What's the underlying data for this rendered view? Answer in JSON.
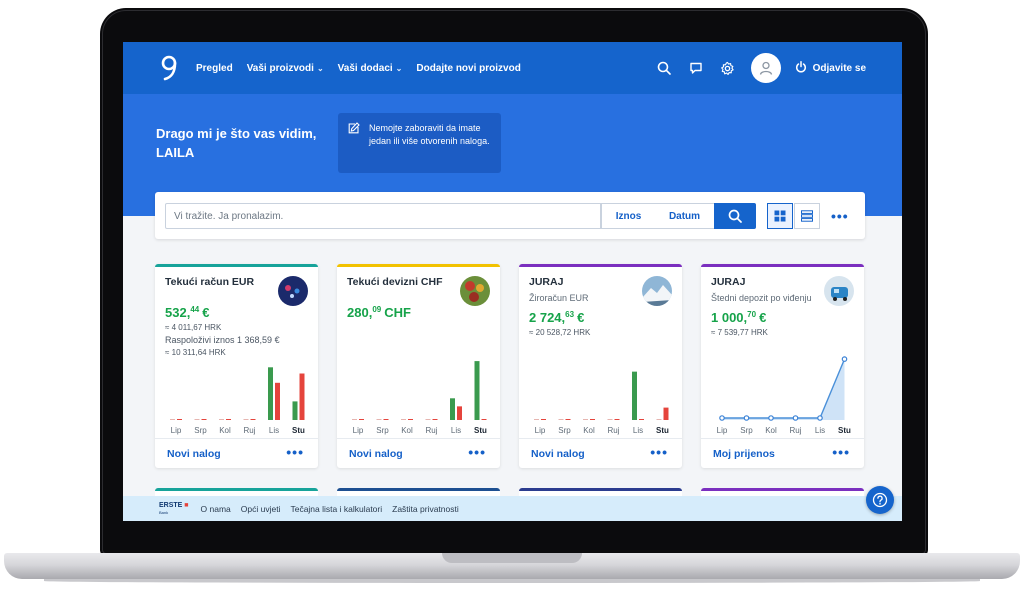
{
  "nav": {
    "items": [
      {
        "label": "Pregled",
        "dropdown": false
      },
      {
        "label": "Vaši proizvodi",
        "dropdown": true
      },
      {
        "label": "Vaši dodaci",
        "dropdown": true
      },
      {
        "label": "Dodajte novi proizvod",
        "dropdown": false
      }
    ],
    "logout_label": "Odjavite se",
    "icons": [
      "search-icon",
      "chat-icon",
      "settings-gear-icon",
      "user-avatar-icon",
      "power-icon"
    ]
  },
  "hero": {
    "greeting_line1": "Drago mi je što vas vidim,",
    "greeting_line2": "LAILA",
    "notice": "Nemojte zaboraviti da imate jedan ili više otvorenih naloga."
  },
  "search": {
    "placeholder": "Vi tražite. Ja pronalazim.",
    "amount_filter": "Iznos",
    "date_filter": "Datum"
  },
  "months": [
    "Lip",
    "Srp",
    "Kol",
    "Ruj",
    "Lis",
    "Stu"
  ],
  "cards": [
    {
      "title": "Tekući račun EUR",
      "subtitle": "",
      "amount_int": "532,",
      "amount_dec": "44",
      "currency": "€",
      "conversion": "≈ 4 011,67 HRK",
      "available_label": "Raspoloživi iznos 1 368,59 €",
      "available_conversion": "≈ 10 311,64 HRK",
      "action": "Novi nalog",
      "accent": "#17a39a",
      "chart": {
        "type": "bar",
        "income": [
          0,
          0,
          0,
          0,
          0.85,
          0.3
        ],
        "expense": [
          0,
          0,
          0,
          0,
          0.6,
          0.75
        ]
      }
    },
    {
      "title": "Tekući devizni CHF",
      "subtitle": "",
      "amount_int": "280,",
      "amount_dec": "09",
      "currency": "CHF",
      "conversion": "",
      "available_label": "",
      "available_conversion": "",
      "action": "Novi nalog",
      "accent": "#f2c200",
      "chart": {
        "type": "bar",
        "income": [
          0,
          0,
          0,
          0,
          0.35,
          0.95
        ],
        "expense": [
          0,
          0,
          0,
          0,
          0.22,
          0
        ]
      }
    },
    {
      "title": "JURAJ",
      "subtitle": "Žiroračun EUR",
      "amount_int": "2 724,",
      "amount_dec": "63",
      "currency": "€",
      "conversion": "≈ 20 528,72 HRK",
      "available_label": "",
      "available_conversion": "",
      "action": "Novi nalog",
      "accent": "#7b2fbf",
      "chart": {
        "type": "bar",
        "income": [
          0,
          0,
          0,
          0,
          0.78,
          0
        ],
        "expense": [
          0,
          0,
          0,
          0,
          0,
          0.2
        ]
      }
    },
    {
      "title": "JURAJ",
      "subtitle": "Štedni depozit po viđenju",
      "amount_int": "1 000,",
      "amount_dec": "70",
      "currency": "€",
      "conversion": "≈ 7 539,77 HRK",
      "available_label": "",
      "available_conversion": "",
      "action": "Moj prijenos",
      "accent": "#7b2fbf",
      "chart": {
        "type": "area",
        "values": [
          0,
          0,
          0,
          0,
          0,
          0.95
        ]
      }
    }
  ],
  "footer": {
    "brand": "ERSTE",
    "brand_sub": "Bank",
    "links": [
      "O nama",
      "Opći uvjeti",
      "Tečajna lista i kalkulatori",
      "Zaštita privatnosti"
    ]
  },
  "colors": {
    "primary": "#1564cc",
    "hero": "#2870e0",
    "positive": "#16a34a",
    "income_bar": "#3a9a4e",
    "expense_bar": "#e5443c"
  }
}
